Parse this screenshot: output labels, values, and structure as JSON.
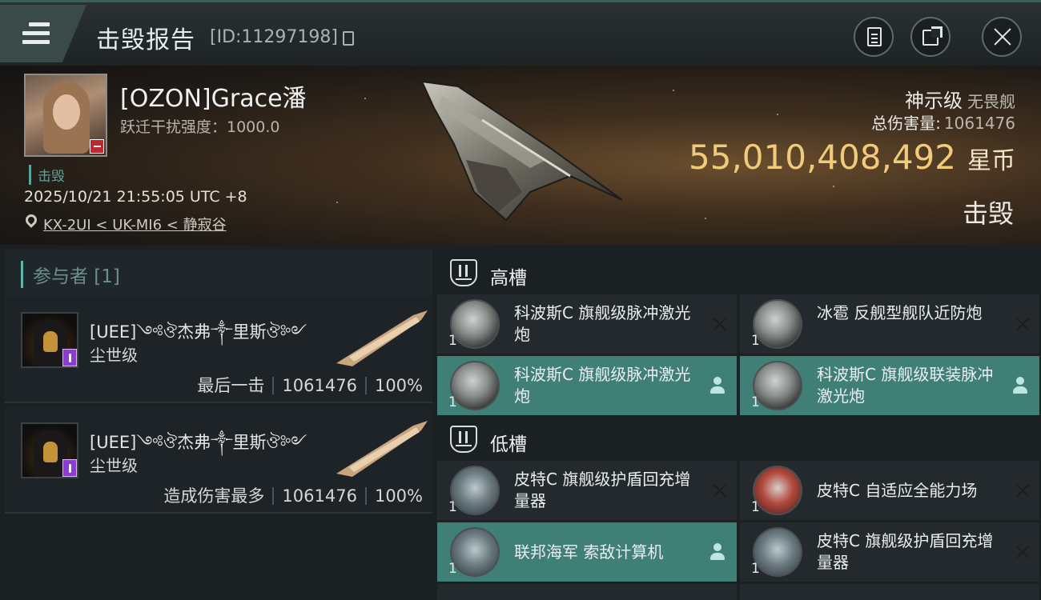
{
  "header": {
    "title": "击毁报告",
    "id_text": "[ID:11297198]",
    "buttons": {
      "notes": "clipboard-icon",
      "share": "share-icon",
      "close": "close-icon"
    }
  },
  "victim": {
    "name": "[OZON]Grace潘",
    "warp_disrupt": "跃迁干扰强度：1000.0",
    "tag": "击毁",
    "datetime": "2025/10/21 21:55:05 UTC +8",
    "location": "KX-2UI < UK-MI6 < 静寂谷",
    "ship_class": "神示级",
    "ship_type": "无畏舰",
    "total_damage_label": "总伤害量:",
    "total_damage_value": "1061476",
    "isk_value": "55,010,408,492",
    "currency": "星币",
    "status": "击毁"
  },
  "participants": {
    "header": "参与者 [1]",
    "cards": [
      {
        "name": "[UEE]༺ঔ杰弗༒里斯ঔ༻",
        "ship": "尘世级",
        "role": "最后一击",
        "damage": "1061476",
        "percent": "100%"
      },
      {
        "name": "[UEE]༺ঔ杰弗༒里斯ঔ༻",
        "ship": "尘世级",
        "role": "造成伤害最多",
        "damage": "1061476",
        "percent": "100%"
      }
    ]
  },
  "fitting": {
    "high_label": "高槽",
    "low_label": "低槽",
    "high": [
      {
        "qty": "1",
        "name": "科波斯C 旗舰级脉冲激光炮",
        "state": "destroyed"
      },
      {
        "qty": "1",
        "name": "冰雹 反舰型舰队近防炮",
        "state": "destroyed"
      },
      {
        "qty": "1",
        "name": "科波斯C 旗舰级脉冲激光炮",
        "state": "dropped"
      },
      {
        "qty": "1",
        "name": "科波斯C 旗舰级联装脉冲激光炮",
        "state": "dropped"
      }
    ],
    "low": [
      {
        "qty": "1",
        "name": "皮特C 旗舰级护盾回充增量器",
        "state": "destroyed"
      },
      {
        "qty": "1",
        "name": "皮特C 自适应全能力场",
        "state": "destroyed"
      },
      {
        "qty": "1",
        "name": "联邦海军 索敌计算机",
        "state": "dropped"
      },
      {
        "qty": "1",
        "name": "皮特C 旗舰级护盾回充增量器",
        "state": "destroyed"
      }
    ]
  },
  "colors": {
    "accent": "#3f7f76",
    "isk": "#f0cc7a",
    "tag": "#5aa39a"
  }
}
